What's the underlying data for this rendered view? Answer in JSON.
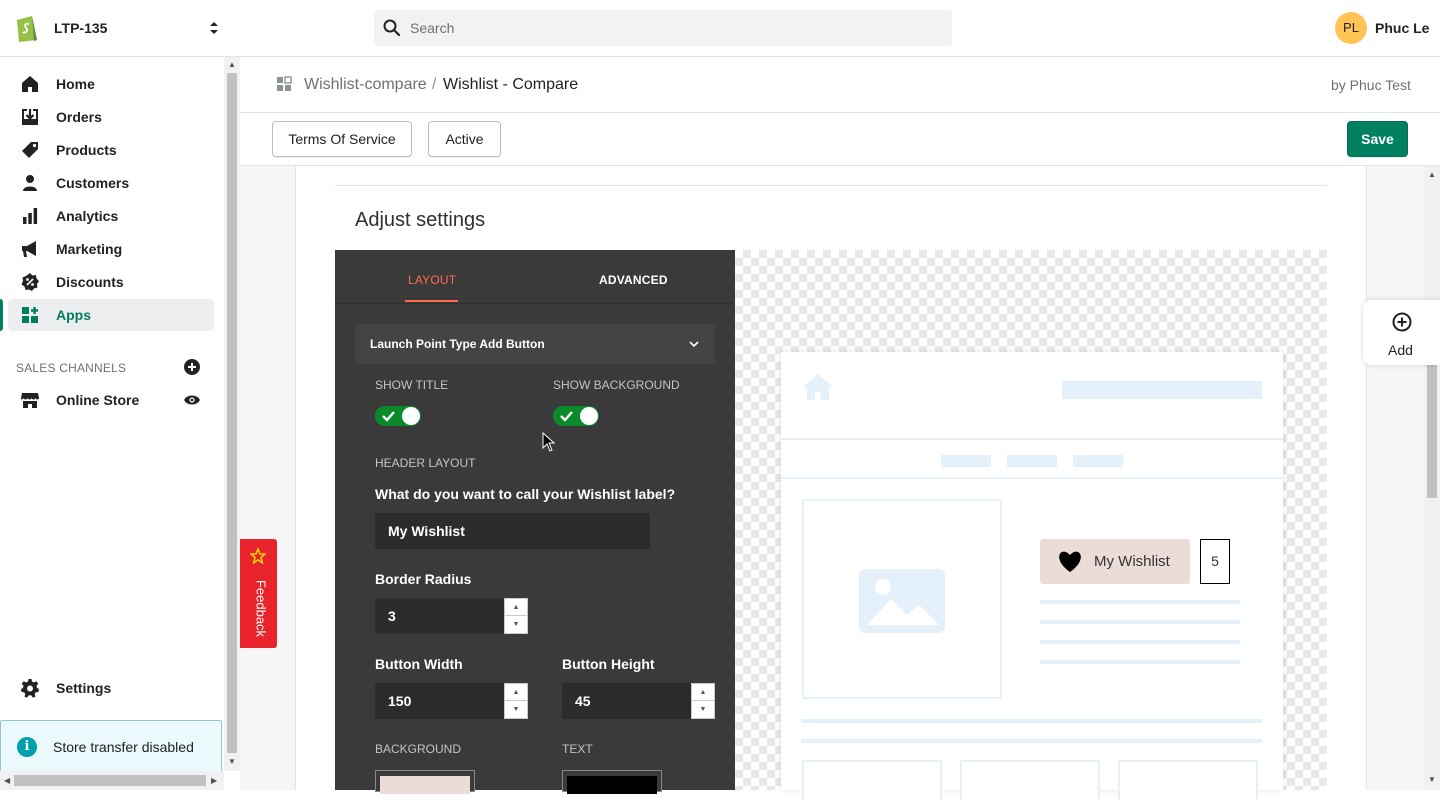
{
  "topbar": {
    "store_name": "LTP-135",
    "search_placeholder": "Search",
    "user_initials": "PL",
    "user_name": "Phuc Le"
  },
  "sidebar": {
    "items": [
      {
        "label": "Home",
        "icon": "home-icon"
      },
      {
        "label": "Orders",
        "icon": "orders-icon"
      },
      {
        "label": "Products",
        "icon": "tag-icon"
      },
      {
        "label": "Customers",
        "icon": "person-icon"
      },
      {
        "label": "Analytics",
        "icon": "bar-chart-icon"
      },
      {
        "label": "Marketing",
        "icon": "megaphone-icon"
      },
      {
        "label": "Discounts",
        "icon": "discount-icon"
      },
      {
        "label": "Apps",
        "icon": "apps-icon",
        "active": true
      }
    ],
    "sales_channels_title": "SALES CHANNELS",
    "online_store": "Online Store",
    "settings": "Settings",
    "store_transfer": "Store transfer disabled"
  },
  "header": {
    "breadcrumb_parent": "Wishlist-compare",
    "breadcrumb_separator": "/",
    "breadcrumb_current": "Wishlist - Compare",
    "by": "by Phuc Test"
  },
  "actions": {
    "terms": "Terms Of Service",
    "active": "Active",
    "save": "Save"
  },
  "card": {
    "title": "Adjust settings"
  },
  "panel": {
    "tabs": [
      "LAYOUT",
      "ADVANCED"
    ],
    "dropdown": "Launch Point Type Add Button",
    "show_title": "SHOW TITLE",
    "show_background": "SHOW BACKGROUND",
    "show_title_on": true,
    "show_background_on": true,
    "header_layout": "HEADER LAYOUT",
    "question": "What do you want to call your Wishlist label?",
    "wishlist_label_value": "My Wishlist",
    "border_radius_label": "Border Radius",
    "border_radius_value": "3",
    "button_width_label": "Button Width",
    "button_width_value": "150",
    "button_height_label": "Button Height",
    "button_height_value": "45",
    "background_label": "BACKGROUND",
    "text_label": "TEXT",
    "background_color": "#ecdcd7",
    "text_color": "#000000"
  },
  "preview": {
    "wishlist_button": "My Wishlist",
    "wishlist_count": "5"
  },
  "floating": {
    "add": "Add",
    "feedback": "Feedback"
  },
  "colors": {
    "accent": "#008060",
    "tab_active": "#ff6a4d",
    "toggle_on": "#0a8a2b",
    "feedback": "#e8232b"
  }
}
